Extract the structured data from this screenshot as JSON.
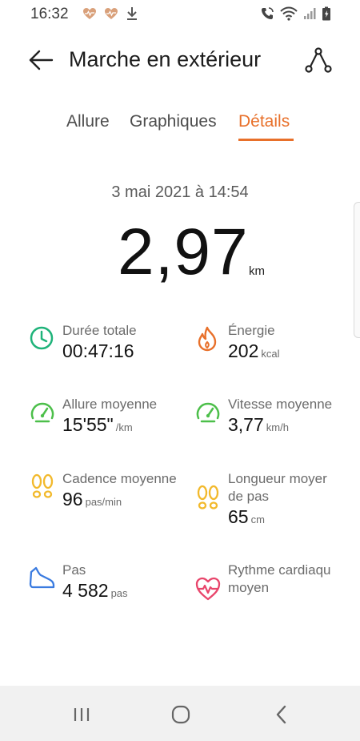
{
  "status_bar": {
    "time": "16:32"
  },
  "header": {
    "title": "Marche en extérieur"
  },
  "tabs": [
    {
      "label": "Allure",
      "active": false
    },
    {
      "label": "Graphiques",
      "active": false
    },
    {
      "label": "Détails",
      "active": true
    }
  ],
  "summary": {
    "date": "3 mai 2021 à 14:54",
    "distance": "2,97",
    "distance_unit": "km"
  },
  "metrics": {
    "duration": {
      "label": "Durée totale",
      "value": "00:47:16",
      "unit": ""
    },
    "energy": {
      "label": "Énergie",
      "value": "202",
      "unit": "kcal"
    },
    "pace": {
      "label": "Allure moyenne",
      "value": "15'55\"",
      "unit": "/km"
    },
    "speed": {
      "label": "Vitesse moyenne",
      "value": "3,77",
      "unit": "km/h"
    },
    "cadence": {
      "label": "Cadence moyenne",
      "value": "96",
      "unit": "pas/min"
    },
    "stride": {
      "label_line1": "Longueur moyer",
      "label_line2": "de pas",
      "value": "65",
      "unit": "cm"
    },
    "steps": {
      "label": "Pas",
      "value": "4 582",
      "unit": "pas"
    },
    "heart_rate": {
      "label_line1": "Rythme cardiaqu",
      "label_line2": "moyen"
    }
  },
  "colors": {
    "accent": "#e8702a",
    "duration_icon": "#1fb37a",
    "energy_icon": "#e8702a",
    "speed_icon": "#4cbf4a",
    "steps_icon": "#f2b92c",
    "shoe_icon": "#3a7be0",
    "heart_icon": "#e8456b"
  }
}
